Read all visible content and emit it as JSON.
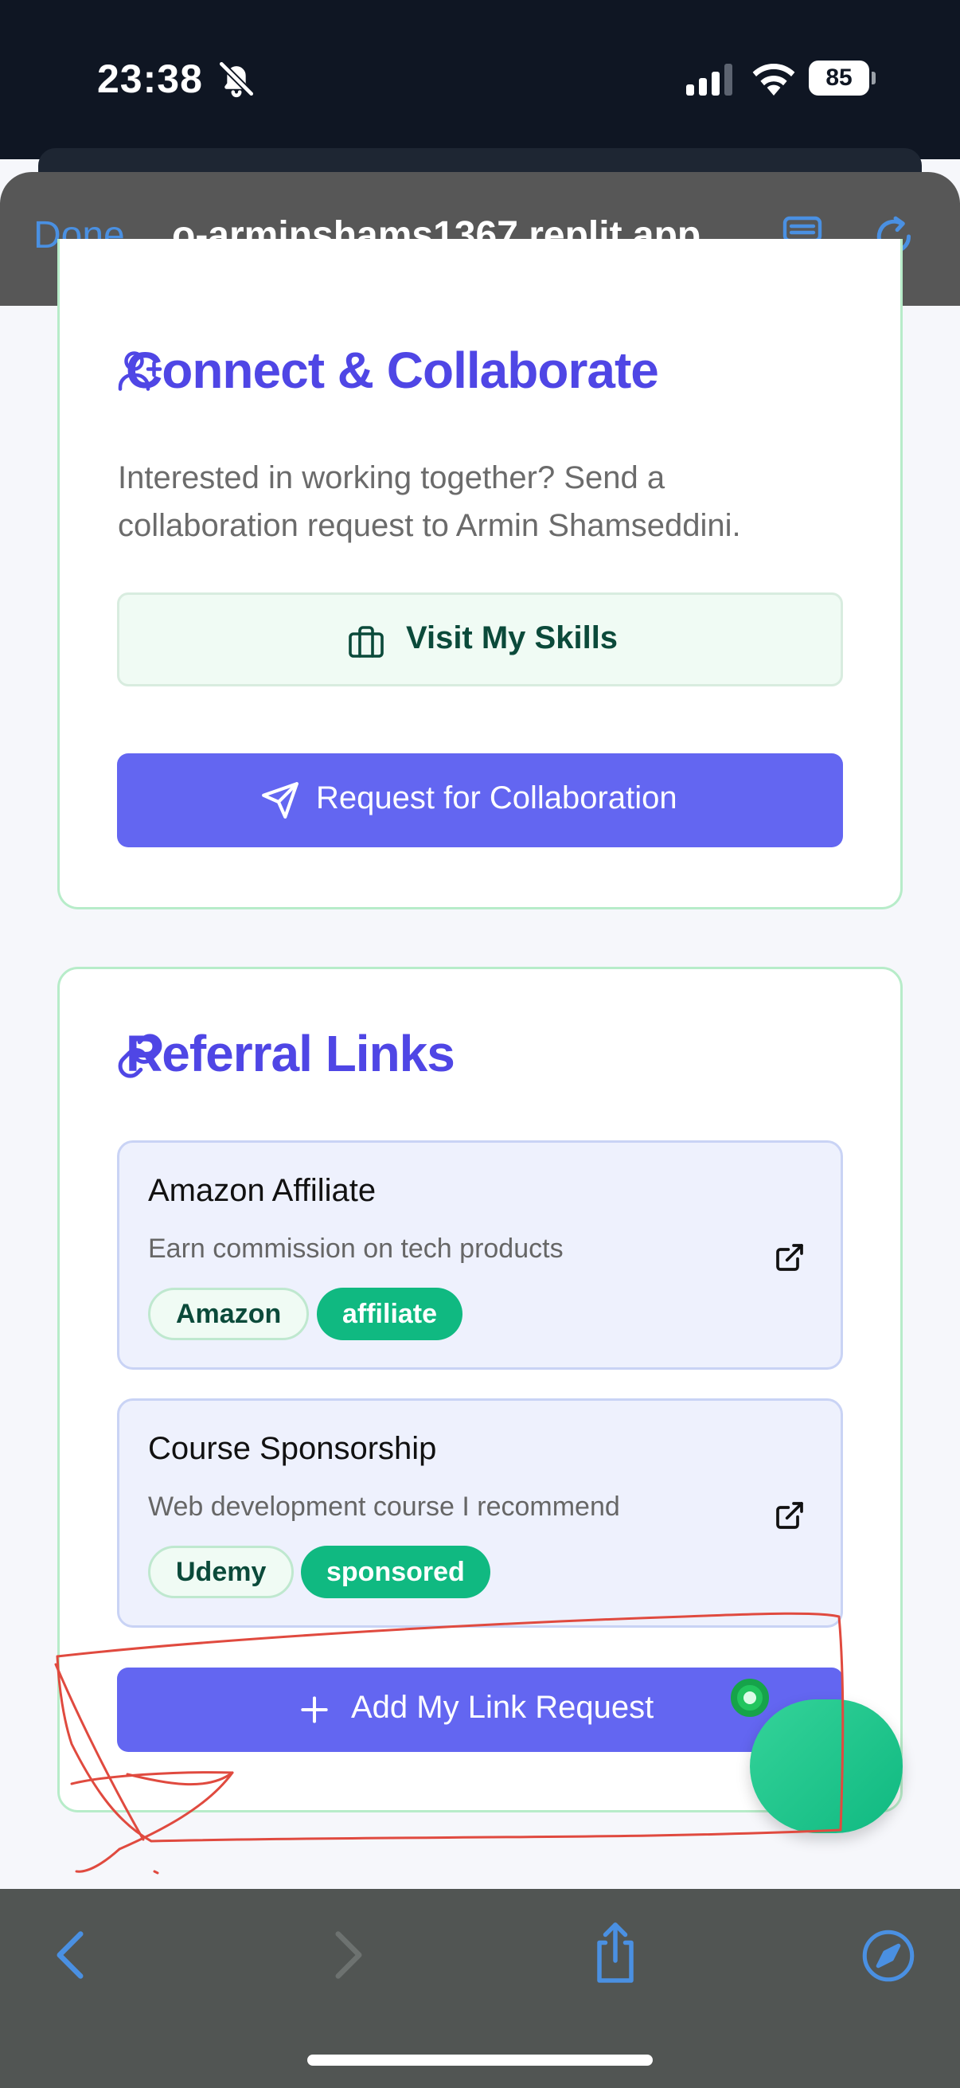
{
  "status_bar": {
    "time": "23:38",
    "battery": "85",
    "icons": [
      "bell-slash-icon",
      "signal-icon",
      "wifi-icon",
      "battery-icon"
    ]
  },
  "browser": {
    "done_label": "Done",
    "url": "o-arminshams1367.replit.app",
    "icons": [
      "reader-icon",
      "reload-icon",
      "back-icon",
      "forward-icon",
      "share-icon",
      "safari-icon"
    ]
  },
  "connect": {
    "title": "Connect & Collaborate",
    "intro": "Interested in working together? Send a collaboration request to Armin Shamseddini.",
    "skills_button": "Visit My Skills",
    "collab_button": "Request for Collaboration"
  },
  "referral": {
    "title": "Referral Links",
    "items": [
      {
        "name": "Amazon Affiliate",
        "description": "Earn commission on tech products",
        "platform": "Amazon",
        "type": "affiliate"
      },
      {
        "name": "Course Sponsorship",
        "description": "Web development course I recommend",
        "platform": "Udemy",
        "type": "sponsored"
      }
    ],
    "add_button": "Add My Link Request"
  },
  "colors": {
    "accent": "#6366f1",
    "title": "#4f46e5",
    "green": "#10b981",
    "annotation": "#e04a3f"
  }
}
